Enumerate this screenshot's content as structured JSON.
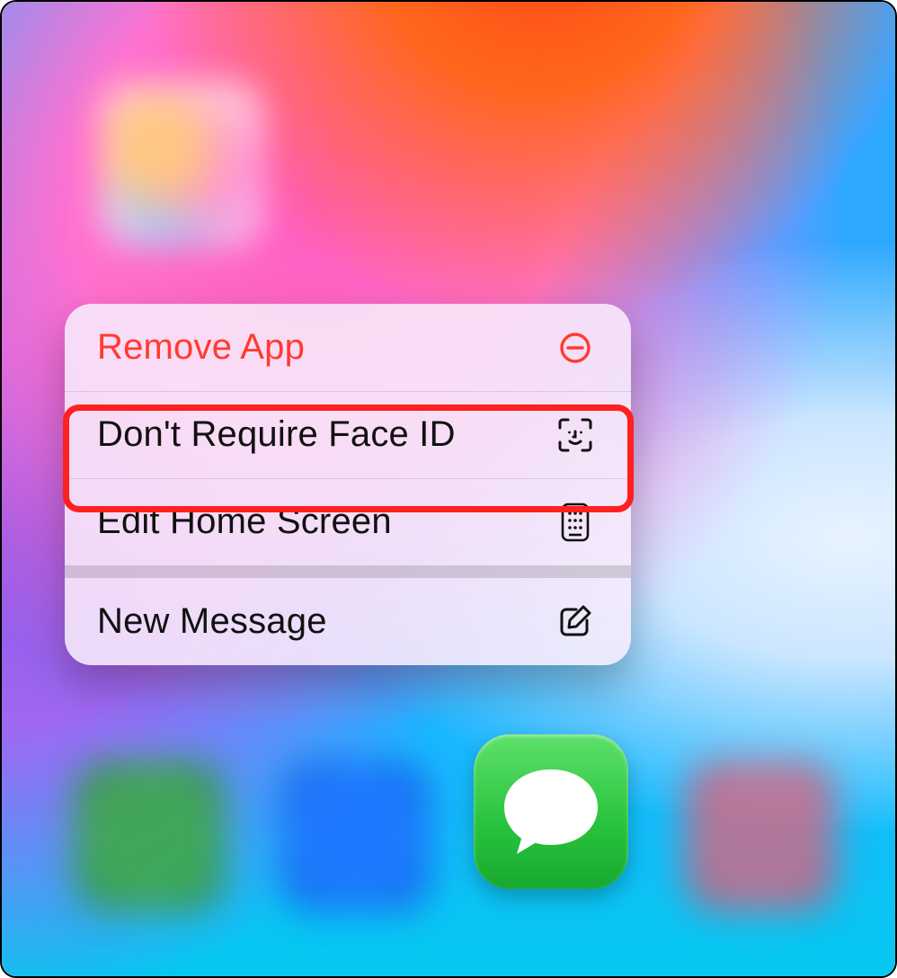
{
  "context_menu": {
    "items": [
      {
        "label": "Remove App",
        "icon": "minus-circle-icon",
        "destructive": true
      },
      {
        "label": "Don't Require Face ID",
        "icon": "face-id-icon",
        "destructive": false
      },
      {
        "label": "Edit Home Screen",
        "icon": "apps-grid-icon",
        "destructive": false
      },
      {
        "label": "New Message",
        "icon": "compose-icon",
        "destructive": false
      }
    ],
    "highlighted_index": 1
  },
  "app": {
    "name": "Messages"
  }
}
